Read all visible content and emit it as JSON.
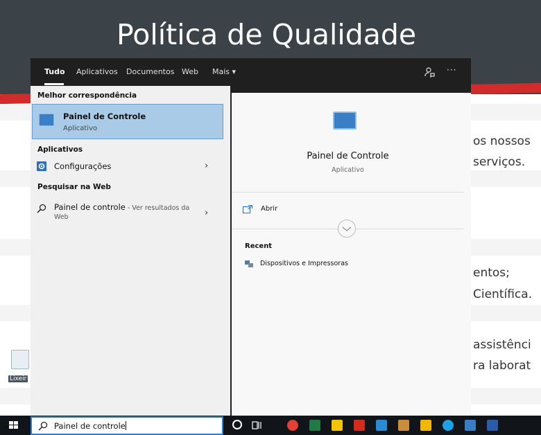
{
  "background": {
    "title": "Política de Qualidade",
    "lines": [
      "os nossos",
      "serviços.",
      "entos;",
      "Científica.",
      "assistênci",
      "ra laborat"
    ],
    "desktop_icon_label": "Lixeir"
  },
  "tabs": [
    {
      "label": "Tudo"
    },
    {
      "label": "Aplicativos"
    },
    {
      "label": "Documentos"
    },
    {
      "label": "Web"
    },
    {
      "label": "Mais ▾"
    }
  ],
  "more_glyph": "···",
  "left": {
    "best_match_header": "Melhor correspondência",
    "best_match": {
      "title": "Painel de Controle",
      "subtitle": "Aplicativo"
    },
    "apps_header": "Aplicativos",
    "apps": [
      {
        "label": "Configurações"
      }
    ],
    "web_header": "Pesquisar na Web",
    "web_result": {
      "query": "Painel de controle",
      "suffix": " - Ver resultados da",
      "suffix2": "Web"
    }
  },
  "right": {
    "title": "Painel de Controle",
    "subtitle": "Aplicativo",
    "open_label": "Abrir",
    "recent_header": "Recent",
    "recent_items": [
      {
        "label": "Dispositivos e Impressoras"
      }
    ]
  },
  "taskbar": {
    "search_value": "Painel de controle",
    "apps": [
      {
        "name": "chrome-icon",
        "color": "#e34133"
      },
      {
        "name": "excel-icon",
        "color": "#1f7a43"
      },
      {
        "name": "sticky-notes-icon",
        "color": "#f5c400"
      },
      {
        "name": "acrobat-icon",
        "color": "#d42b1e"
      },
      {
        "name": "app-blue-icon",
        "color": "#2a8ad4"
      },
      {
        "name": "paint-icon",
        "color": "#c98e3a"
      },
      {
        "name": "file-explorer-icon",
        "color": "#f2b705"
      },
      {
        "name": "skype-icon",
        "color": "#1aa1e6"
      },
      {
        "name": "control-panel-icon",
        "color": "#3a7fc6"
      },
      {
        "name": "word-icon",
        "color": "#2b5caa"
      }
    ]
  },
  "colors": {
    "accent": "#2d7dd2",
    "selection": "#a9cbe8",
    "panel_dark": "#1f1f1f"
  }
}
